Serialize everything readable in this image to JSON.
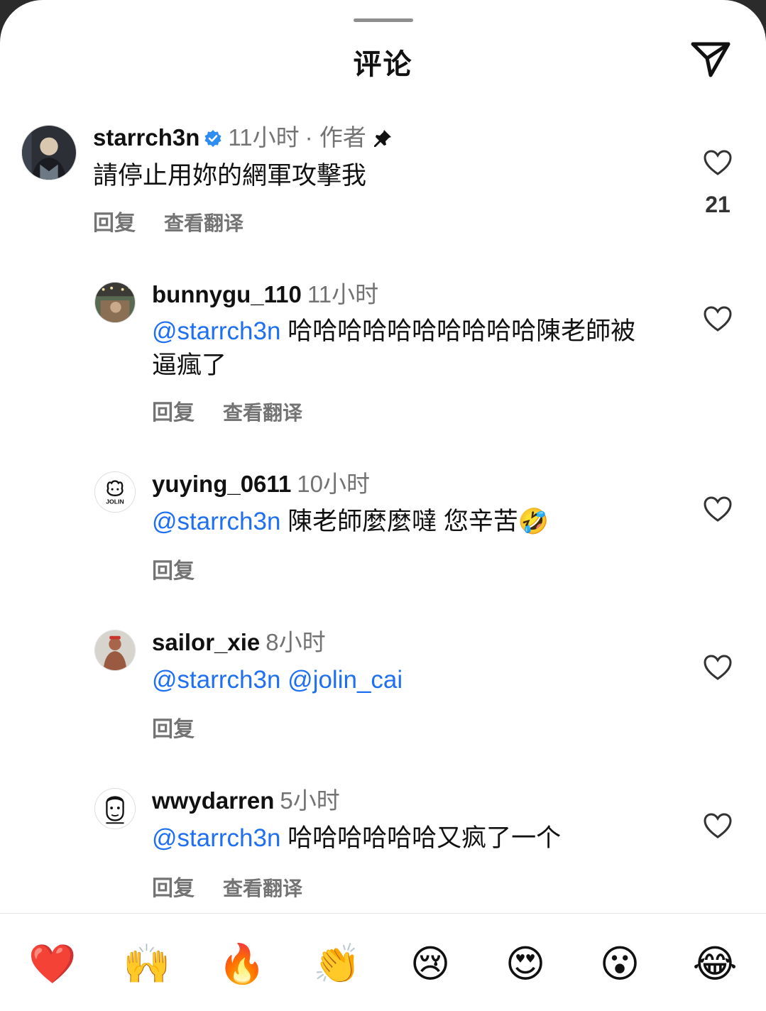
{
  "header": {
    "title": "评论"
  },
  "comments": [
    {
      "username": "starrch3n",
      "time": "11小时",
      "author_tag": "· 作者",
      "text": "請停止用妳的網軍攻擊我",
      "reply_label": "回复",
      "translate_label": "查看翻译",
      "likes": "21"
    },
    {
      "username": "bunnygu_110",
      "time": "11小时",
      "mention": "@starrch3n",
      "text": " 哈哈哈哈哈哈哈哈哈哈陳老師被逼瘋了",
      "reply_label": "回复",
      "translate_label": "查看翻译"
    },
    {
      "username": "yuying_0611",
      "time": "10小时",
      "mention": "@starrch3n",
      "text": " 陳老師麼麼噠 您辛苦🤣",
      "reply_label": "回复",
      "avatar_text": "JOLIN"
    },
    {
      "username": "sailor_xie",
      "time": "8小时",
      "mention": "@starrch3n",
      "mention2": " @jolin_cai",
      "reply_label": "回复"
    },
    {
      "username": "wwydarren",
      "time": "5小时",
      "mention": "@starrch3n",
      "text": " 哈哈哈哈哈哈又疯了一个",
      "reply_label": "回复",
      "translate_label": "查看翻译"
    }
  ],
  "emoji_bar": [
    "❤️",
    "🙌",
    "🔥",
    "👏",
    "😢",
    "😍",
    "😮",
    "😂"
  ],
  "colors": {
    "mention": "#1f6ff2",
    "secondary_text": "#737373",
    "verified_badge": "#2f8cf0"
  }
}
